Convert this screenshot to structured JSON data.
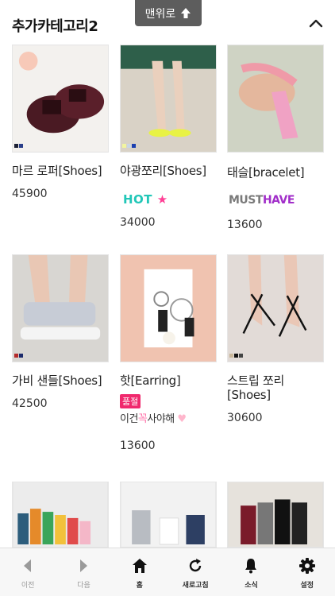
{
  "header": {
    "title": "추가카테고리2",
    "to_top_label": "맨위로"
  },
  "products": [
    {
      "name": "마르 로퍼[Shoes]",
      "price": "45900",
      "swatches": [
        "#1c2035",
        "#2a3f8a"
      ]
    },
    {
      "name": "야광쪼리[Shoes]",
      "price": "34000",
      "swatches": [
        "#f2f5a0",
        "#c9d6e6",
        "#1b3fb0"
      ],
      "badge": "HOT"
    },
    {
      "name": "태슬[bracelet]",
      "price": "13600",
      "badge_a": "MUST",
      "badge_b": "HAVE"
    },
    {
      "name": "가비 샌들[Shoes]",
      "price": "42500",
      "swatches": [
        "#b52b2b",
        "#1b2a6b"
      ]
    },
    {
      "name": "핫[Earring]",
      "price": "13600",
      "soldout": "품절",
      "tag_a": "이건",
      "tag_b": "꼭",
      "tag_c": "사야해"
    },
    {
      "name": "스트립 쪼리",
      "name2": "[Shoes]",
      "price": "30600",
      "swatches": [
        "#c9b79a",
        "#111111",
        "#444444"
      ]
    }
  ],
  "nav": [
    {
      "label": "이전",
      "icon": "back-icon",
      "enabled": false
    },
    {
      "label": "다음",
      "icon": "forward-icon",
      "enabled": false
    },
    {
      "label": "홈",
      "icon": "home-icon",
      "enabled": true
    },
    {
      "label": "새로고침",
      "icon": "refresh-icon",
      "enabled": true
    },
    {
      "label": "소식",
      "icon": "bell-icon",
      "enabled": true
    },
    {
      "label": "설정",
      "icon": "gear-icon",
      "enabled": true
    }
  ],
  "colors": {
    "accent_pink": "#f0296d",
    "nav_bg": "#f7f7f7",
    "to_top_bg": "#5d5d5d"
  }
}
